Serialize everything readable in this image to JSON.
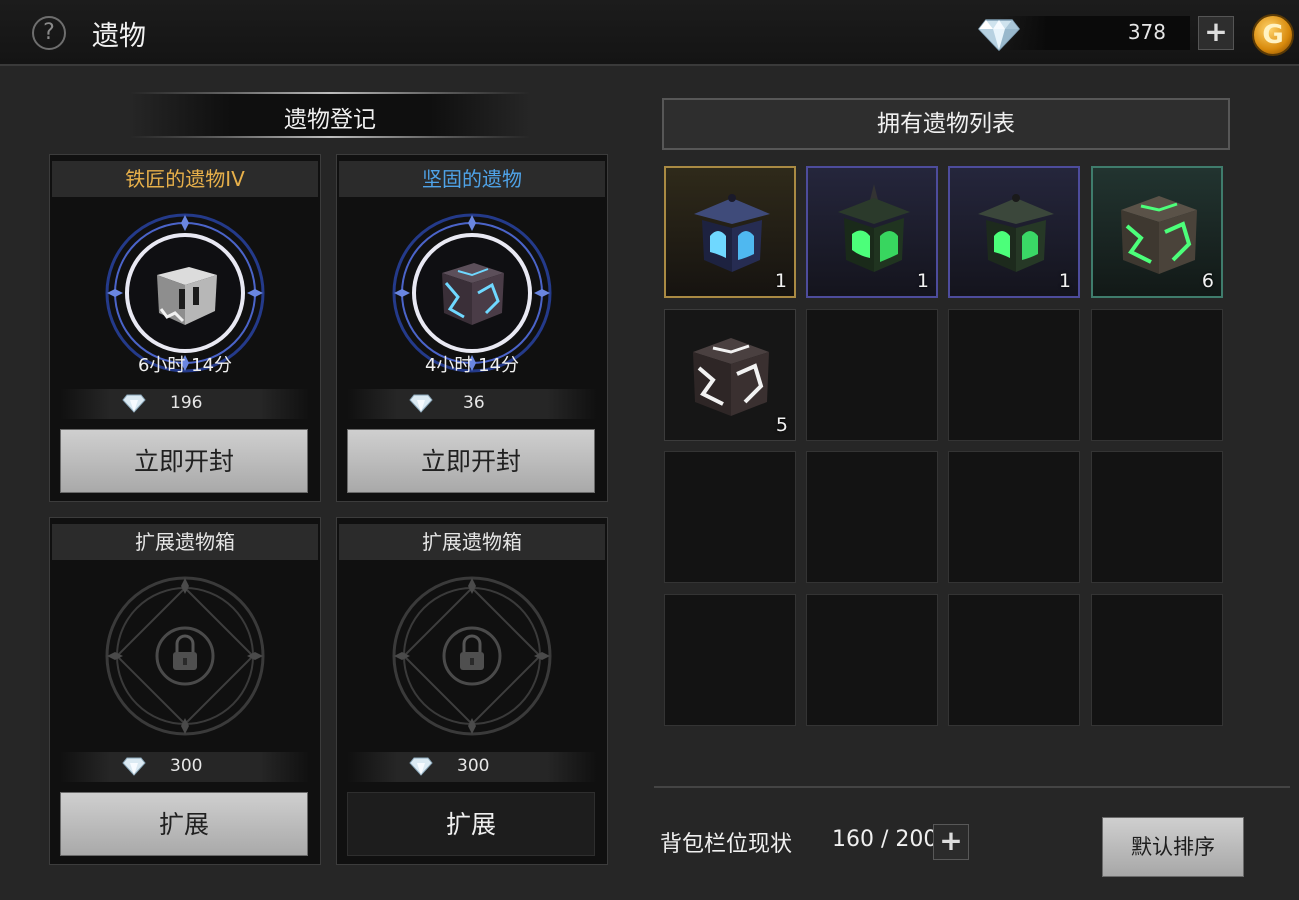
{
  "header": {
    "help_glyph": "?",
    "title": "遗物",
    "gems": "378",
    "plus": "+",
    "gold_glyph": "G"
  },
  "registration": {
    "title": "遗物登记",
    "slots": [
      {
        "name": "铁匠的遗物IV",
        "name_color": "#e7b04a",
        "timer": "6小时 14分",
        "cost": "196",
        "button": "立即开封",
        "icon": "iron-relic-box-icon"
      },
      {
        "name": "坚固的遗物",
        "name_color": "#4fa3e8",
        "timer": "4小时 14分",
        "cost": "36",
        "button": "立即开封",
        "icon": "sturdy-relic-box-icon"
      },
      {
        "name": "扩展遗物箱",
        "name_color": "#e6e6e6",
        "cost": "300",
        "button": "扩展",
        "icon": "lock-icon"
      },
      {
        "name": "扩展遗物箱",
        "name_color": "#e6e6e6",
        "cost": "300",
        "button": "扩展",
        "icon": "lock-icon"
      }
    ]
  },
  "owned": {
    "title": "拥有遗物列表",
    "items": [
      {
        "icon": "blue-lantern-relic-icon",
        "count": "1",
        "rarity": "gold"
      },
      {
        "icon": "green-shrine-relic-icon",
        "count": "1",
        "rarity": "blue"
      },
      {
        "icon": "green-lantern-relic-icon",
        "count": "1",
        "rarity": "blue"
      },
      {
        "icon": "green-cube-relic-icon",
        "count": "6",
        "rarity": "teal"
      },
      {
        "icon": "white-cube-relic-icon",
        "count": "5",
        "rarity": "plain"
      }
    ],
    "capacity_label": "背包栏位现状",
    "capacity_value": "160 / 200",
    "capacity_plus": "+",
    "sort_button": "默认排序"
  },
  "colors": {
    "rarity_gold": "#a98a43",
    "rarity_blue": "#4d4c9c",
    "rarity_teal": "#3f7c6c",
    "relic_glow_blue": "#6fd8ff",
    "relic_glow_green": "#4cff7a"
  }
}
